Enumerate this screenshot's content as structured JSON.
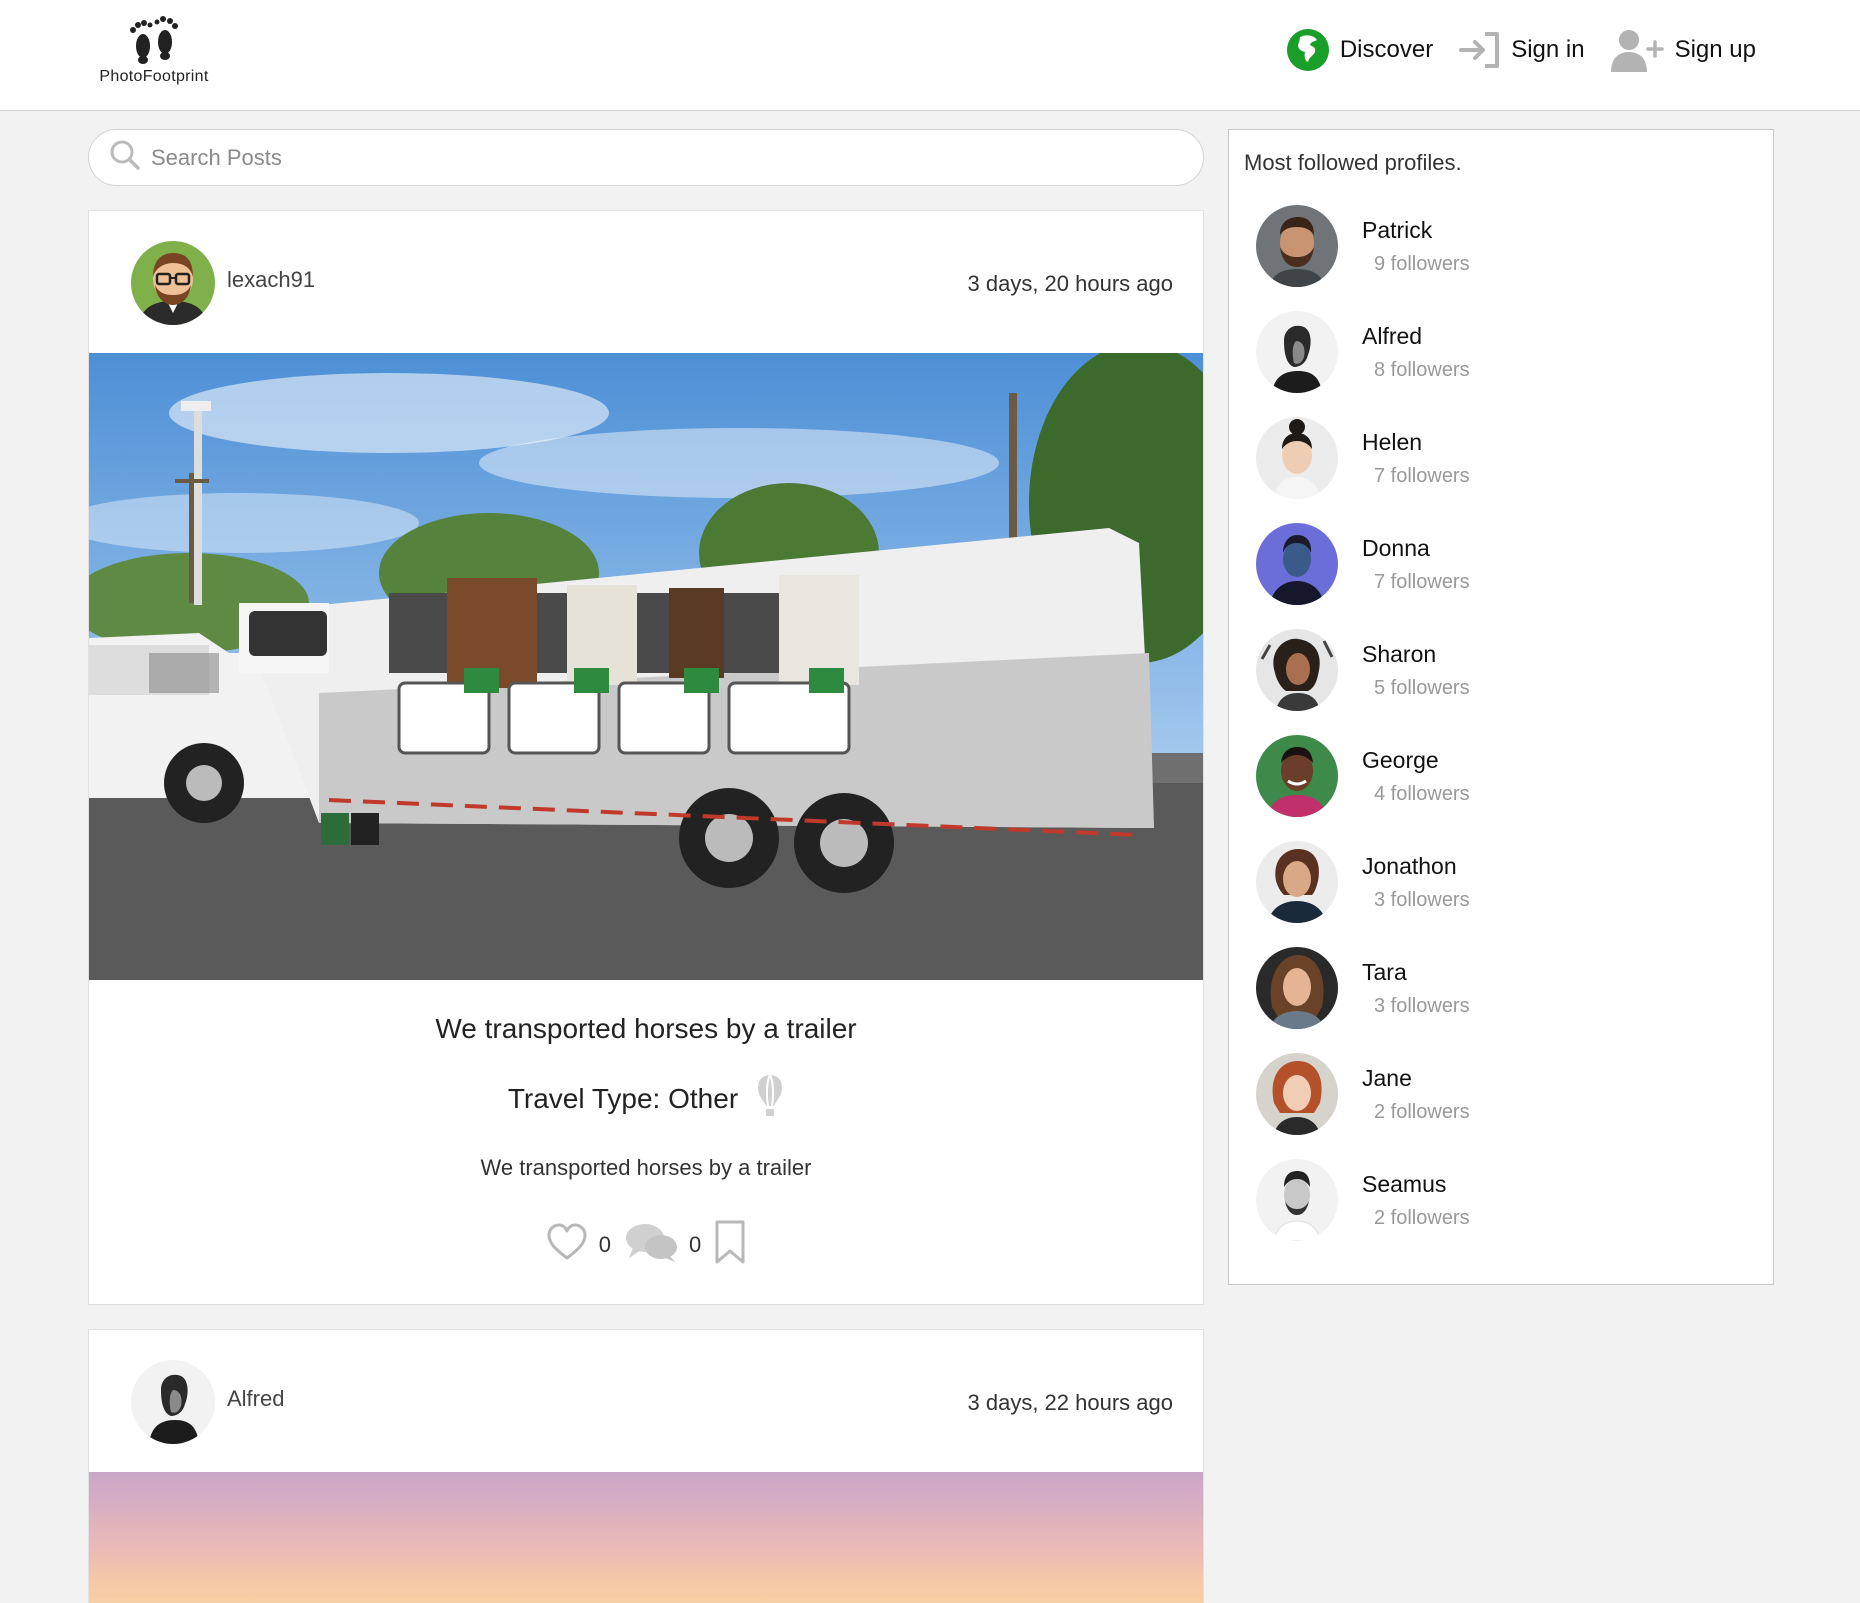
{
  "header": {
    "logo_text": "PhotoFootprint",
    "nav": [
      {
        "label": "Discover",
        "icon": "globe-icon"
      },
      {
        "label": "Sign in",
        "icon": "sign-in-icon"
      },
      {
        "label": "Sign up",
        "icon": "add-user-icon"
      }
    ]
  },
  "search": {
    "placeholder": "Search Posts"
  },
  "posts": [
    {
      "username": "lexach91",
      "time": "3 days, 20 hours ago",
      "title": "We transported horses by a trailer",
      "travel_type": "Travel Type: Other",
      "description": "We transported horses by a trailer",
      "likes": "0",
      "comments": "0"
    },
    {
      "username": "Alfred",
      "time": "3 days, 22 hours ago"
    }
  ],
  "sidebar": {
    "title": "Most followed profiles.",
    "profiles": [
      {
        "name": "Patrick",
        "followers": "9 followers"
      },
      {
        "name": "Alfred",
        "followers": "8 followers"
      },
      {
        "name": "Helen",
        "followers": "7 followers"
      },
      {
        "name": "Donna",
        "followers": "7 followers"
      },
      {
        "name": "Sharon",
        "followers": "5 followers"
      },
      {
        "name": "George",
        "followers": "4 followers"
      },
      {
        "name": "Jonathon",
        "followers": "3 followers"
      },
      {
        "name": "Tara",
        "followers": "3 followers"
      },
      {
        "name": "Jane",
        "followers": "2 followers"
      },
      {
        "name": "Seamus",
        "followers": "2 followers"
      }
    ]
  },
  "colors": {
    "discover_green": "#1a9e2a",
    "muted_icon": "#b3b3b3",
    "background": "#f2f2f2"
  }
}
